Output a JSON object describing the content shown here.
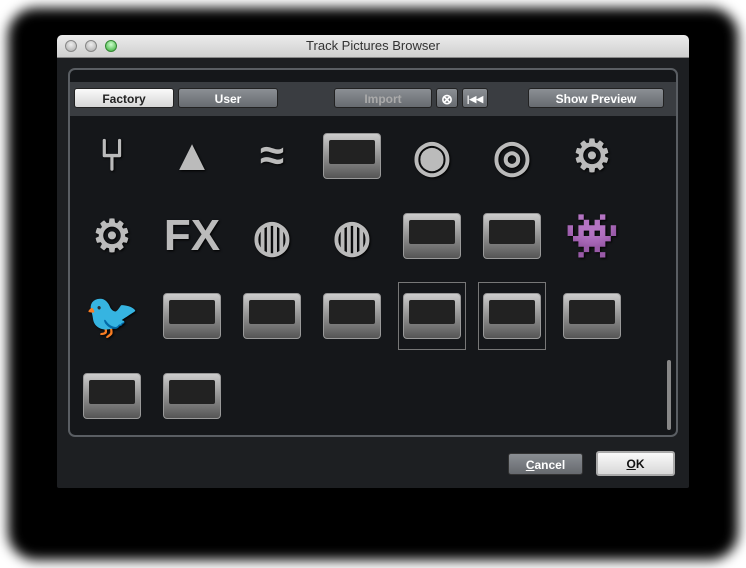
{
  "window": {
    "title": "Track Pictures Browser"
  },
  "toolbar": {
    "factory": "Factory",
    "user": "User",
    "import": "Import",
    "clear_icon": "x-circle-icon",
    "reset_icon": "skip-back-icon",
    "show_preview": "Show Preview"
  },
  "pictures": [
    {
      "icon": "tuning-fork",
      "glyph": "⑂",
      "kind": "glyph"
    },
    {
      "icon": "metronome",
      "glyph": "▲",
      "kind": "glyph"
    },
    {
      "icon": "waveform",
      "glyph": "≈",
      "kind": "glyph"
    },
    {
      "icon": "radio",
      "kind": "dev"
    },
    {
      "icon": "speaker",
      "glyph": "◉",
      "kind": "glyph"
    },
    {
      "icon": "speaker-small",
      "glyph": "◎",
      "kind": "glyph"
    },
    {
      "icon": "gear",
      "glyph": "⚙",
      "kind": "glyph"
    },
    {
      "icon": "gears",
      "glyph": "⚙",
      "kind": "glyph"
    },
    {
      "icon": "fx",
      "glyph": "FX",
      "kind": "glyph"
    },
    {
      "icon": "turntable",
      "glyph": "◍",
      "kind": "glyph"
    },
    {
      "icon": "turntable-2",
      "glyph": "◍",
      "kind": "glyph"
    },
    {
      "icon": "drum-machine",
      "kind": "dev"
    },
    {
      "icon": "mixer",
      "kind": "dev"
    },
    {
      "icon": "space-invader",
      "glyph": "👾",
      "kind": "glyph"
    },
    {
      "icon": "bird",
      "glyph": "🐦",
      "kind": "glyph"
    },
    {
      "icon": "sampler",
      "kind": "dev"
    },
    {
      "icon": "plugin-1",
      "kind": "dev"
    },
    {
      "icon": "plugin-2",
      "kind": "dev"
    },
    {
      "icon": "synth-1",
      "kind": "dev",
      "selected": true
    },
    {
      "icon": "synth-2",
      "kind": "dev",
      "selected": true
    },
    {
      "icon": "plugin-3",
      "kind": "dev"
    },
    {
      "icon": "plugin-4",
      "kind": "dev"
    },
    {
      "icon": "plugin-5",
      "kind": "dev"
    }
  ],
  "footer": {
    "cancel_pre": "",
    "cancel_u": "C",
    "cancel_rest": "ancel",
    "ok_u": "O",
    "ok_rest": "K"
  }
}
